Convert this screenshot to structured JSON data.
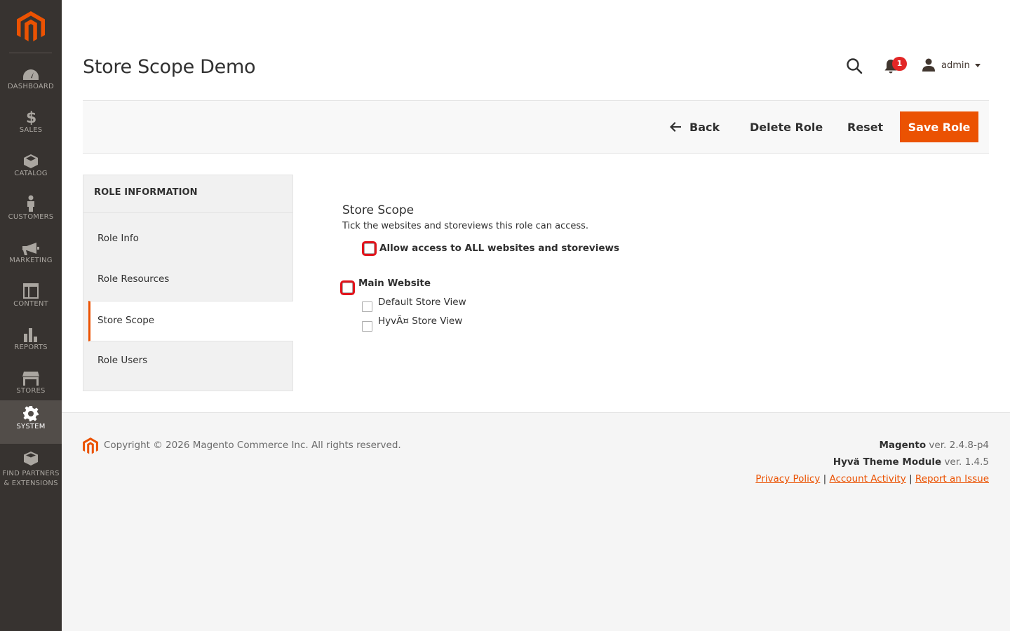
{
  "sidebar": {
    "items": [
      {
        "label": "DASHBOARD",
        "icon": "dashboard-icon"
      },
      {
        "label": "SALES",
        "icon": "dollar-icon"
      },
      {
        "label": "CATALOG",
        "icon": "box-icon"
      },
      {
        "label": "CUSTOMERS",
        "icon": "person-icon"
      },
      {
        "label": "MARKETING",
        "icon": "megaphone-icon"
      },
      {
        "label": "CONTENT",
        "icon": "layout-icon"
      },
      {
        "label": "REPORTS",
        "icon": "bar-chart-icon"
      },
      {
        "label": "STORES",
        "icon": "storefront-icon"
      },
      {
        "label": "SYSTEM",
        "icon": "gear-icon",
        "active": true
      },
      {
        "label_line1": "FIND PARTNERS",
        "label_line2": "& EXTENSIONS",
        "icon": "blocks-icon"
      }
    ]
  },
  "header": {
    "title": "Store Scope Demo",
    "notifications_count": "1",
    "user_name": "admin"
  },
  "actions": {
    "back": "Back",
    "delete": "Delete Role",
    "reset": "Reset",
    "save": "Save Role"
  },
  "tabs": {
    "title": "ROLE INFORMATION",
    "items": [
      "Role Info",
      "Role Resources",
      "Store Scope",
      "Role Users"
    ],
    "active": "Store Scope"
  },
  "scope": {
    "title": "Store Scope",
    "description": "Tick the websites and storeviews this role can access.",
    "all_label": "Allow access to ALL websites and storeviews",
    "website": "Main Website",
    "store_views": [
      "Default Store View",
      "HyvÃ¤ Store View"
    ]
  },
  "footer": {
    "copyright": "Copyright © 2026 Magento Commerce Inc. All rights reserved.",
    "magento_name": "Magento",
    "magento_ver": " ver. 2.4.8-p4",
    "hyva_name": "Hyvä Theme Module",
    "hyva_ver": " ver. 1.4.5",
    "links": [
      "Privacy Policy",
      "Account Activity",
      "Report an Issue"
    ],
    "sep": "|"
  },
  "colors": {
    "accent": "#eb5202",
    "sidebar_bg": "#373330",
    "highlight": "#e1141c"
  }
}
